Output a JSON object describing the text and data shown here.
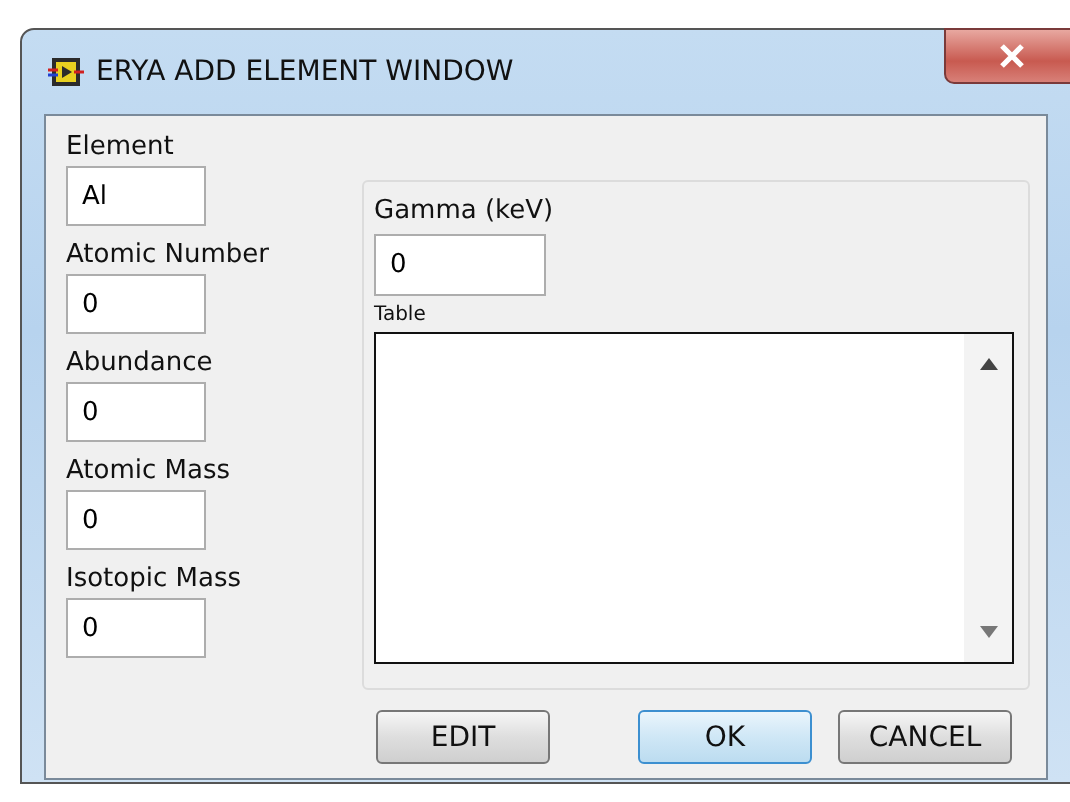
{
  "window": {
    "title": "ERYA ADD ELEMENT WINDOW"
  },
  "fields": [
    {
      "label": "Element",
      "value": "Al"
    },
    {
      "label": "Atomic Number",
      "value": "0"
    },
    {
      "label": "Abundance",
      "value": "0"
    },
    {
      "label": "Atomic Mass",
      "value": "0"
    },
    {
      "label": "Isotopic Mass",
      "value": "0"
    }
  ],
  "gamma": {
    "label": "Gamma (keV)",
    "value": "0"
  },
  "table": {
    "label": "Table"
  },
  "buttons": [
    {
      "label": "EDIT",
      "default": false
    },
    {
      "label": "OK",
      "default": true
    },
    {
      "label": "CANCEL",
      "default": false
    }
  ]
}
